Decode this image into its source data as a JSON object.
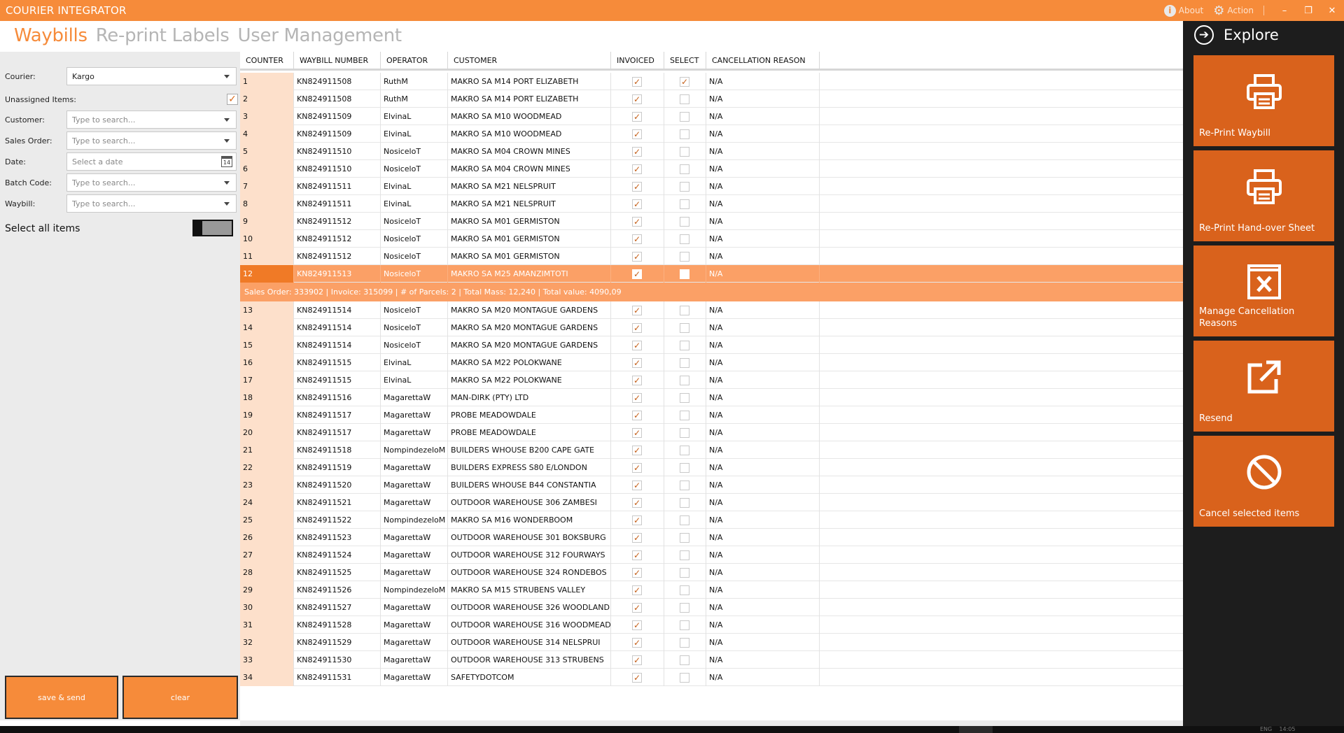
{
  "app": {
    "title": "COURIER INTEGRATOR",
    "about_label": "About",
    "action_label": "Action",
    "about_icon": "i",
    "gear_icon": "⚙",
    "minimize_glyph": "–",
    "restore_glyph": "❐",
    "close_glyph": "✕"
  },
  "nav": {
    "tabs": [
      "Waybills",
      "Re-print Labels",
      "User Management"
    ],
    "active": "Waybills"
  },
  "filters": {
    "courier": {
      "label": "Courier:",
      "value": "Kargo"
    },
    "unassigned": {
      "label": "Unassigned Items:",
      "checked": true,
      "check_glyph": "✓"
    },
    "customer": {
      "label": "Customer:",
      "placeholder": "Type to search..."
    },
    "sales_order": {
      "label": "Sales Order:",
      "placeholder": "Type to search..."
    },
    "date": {
      "label": "Date:",
      "placeholder": "Select a date",
      "cal_day": "14"
    },
    "batch_code": {
      "label": "Batch Code:",
      "placeholder": "Type to search..."
    },
    "waybill": {
      "label": "Waybill:",
      "placeholder": "Type to search..."
    },
    "select_all_label": "Select all items",
    "save_send_label": "save & send",
    "clear_label": "clear"
  },
  "grid": {
    "columns": [
      "COUNTER",
      "WAYBILL NUMBER",
      "OPERATOR",
      "CUSTOMER",
      "INVOICED",
      "SELECT",
      "CANCELLATION REASON"
    ],
    "check_glyph": "✓",
    "selected_counter": "12",
    "detail_text": "Sales Order: 333902 | Invoice: 315099 | # of Parcels: 2 | Total Mass: 12,240 | Total value: 4090,09",
    "rows": [
      {
        "counter": "1",
        "waybill": "KN824911508",
        "operator": "RuthM",
        "customer": "MAKRO SA M14 PORT ELIZABETH",
        "invoiced": true,
        "select": true,
        "reason": "N/A"
      },
      {
        "counter": "2",
        "waybill": "KN824911508",
        "operator": "RuthM",
        "customer": "MAKRO SA M14 PORT ELIZABETH",
        "invoiced": true,
        "select": false,
        "reason": "N/A"
      },
      {
        "counter": "3",
        "waybill": "KN824911509",
        "operator": "ElvinaL",
        "customer": "MAKRO SA M10 WOODMEAD",
        "invoiced": true,
        "select": false,
        "reason": "N/A"
      },
      {
        "counter": "4",
        "waybill": "KN824911509",
        "operator": "ElvinaL",
        "customer": "MAKRO SA M10 WOODMEAD",
        "invoiced": true,
        "select": false,
        "reason": "N/A"
      },
      {
        "counter": "5",
        "waybill": "KN824911510",
        "operator": "NosiceloT",
        "customer": "MAKRO SA M04 CROWN MINES",
        "invoiced": true,
        "select": false,
        "reason": "N/A"
      },
      {
        "counter": "6",
        "waybill": "KN824911510",
        "operator": "NosiceloT",
        "customer": "MAKRO SA M04 CROWN MINES",
        "invoiced": true,
        "select": false,
        "reason": "N/A"
      },
      {
        "counter": "7",
        "waybill": "KN824911511",
        "operator": "ElvinaL",
        "customer": "MAKRO SA M21 NELSPRUIT",
        "invoiced": true,
        "select": false,
        "reason": "N/A"
      },
      {
        "counter": "8",
        "waybill": "KN824911511",
        "operator": "ElvinaL",
        "customer": "MAKRO SA M21 NELSPRUIT",
        "invoiced": true,
        "select": false,
        "reason": "N/A"
      },
      {
        "counter": "9",
        "waybill": "KN824911512",
        "operator": "NosiceloT",
        "customer": "MAKRO SA M01 GERMISTON",
        "invoiced": true,
        "select": false,
        "reason": "N/A"
      },
      {
        "counter": "10",
        "waybill": "KN824911512",
        "operator": "NosiceloT",
        "customer": "MAKRO SA M01 GERMISTON",
        "invoiced": true,
        "select": false,
        "reason": "N/A"
      },
      {
        "counter": "11",
        "waybill": "KN824911512",
        "operator": "NosiceloT",
        "customer": "MAKRO SA M01 GERMISTON",
        "invoiced": true,
        "select": false,
        "reason": "N/A"
      },
      {
        "counter": "12",
        "waybill": "KN824911513",
        "operator": "NosiceloT",
        "customer": "MAKRO SA M25 AMANZIMTOTI",
        "invoiced": true,
        "select": false,
        "reason": "N/A"
      },
      {
        "counter": "13",
        "waybill": "KN824911514",
        "operator": "NosiceloT",
        "customer": "MAKRO SA M20 MONTAGUE GARDENS",
        "invoiced": true,
        "select": false,
        "reason": "N/A"
      },
      {
        "counter": "14",
        "waybill": "KN824911514",
        "operator": "NosiceloT",
        "customer": "MAKRO SA M20 MONTAGUE GARDENS",
        "invoiced": true,
        "select": false,
        "reason": "N/A"
      },
      {
        "counter": "15",
        "waybill": "KN824911514",
        "operator": "NosiceloT",
        "customer": "MAKRO SA M20 MONTAGUE GARDENS",
        "invoiced": true,
        "select": false,
        "reason": "N/A"
      },
      {
        "counter": "16",
        "waybill": "KN824911515",
        "operator": "ElvinaL",
        "customer": "MAKRO SA M22 POLOKWANE",
        "invoiced": true,
        "select": false,
        "reason": "N/A"
      },
      {
        "counter": "17",
        "waybill": "KN824911515",
        "operator": "ElvinaL",
        "customer": "MAKRO SA M22 POLOKWANE",
        "invoiced": true,
        "select": false,
        "reason": "N/A"
      },
      {
        "counter": "18",
        "waybill": "KN824911516",
        "operator": "MagarettaW",
        "customer": "MAN-DIRK (PTY) LTD",
        "invoiced": true,
        "select": false,
        "reason": "N/A"
      },
      {
        "counter": "19",
        "waybill": "KN824911517",
        "operator": "MagarettaW",
        "customer": "PROBE MEADOWDALE",
        "invoiced": true,
        "select": false,
        "reason": "N/A"
      },
      {
        "counter": "20",
        "waybill": "KN824911517",
        "operator": "MagarettaW",
        "customer": "PROBE MEADOWDALE",
        "invoiced": true,
        "select": false,
        "reason": "N/A"
      },
      {
        "counter": "21",
        "waybill": "KN824911518",
        "operator": "NompindezeloM",
        "customer": "BUILDERS WHOUSE B200 CAPE GATE",
        "invoiced": true,
        "select": false,
        "reason": "N/A"
      },
      {
        "counter": "22",
        "waybill": "KN824911519",
        "operator": "MagarettaW",
        "customer": "BUILDERS EXPRESS S80 E/LONDON",
        "invoiced": true,
        "select": false,
        "reason": "N/A"
      },
      {
        "counter": "23",
        "waybill": "KN824911520",
        "operator": "MagarettaW",
        "customer": "BUILDERS WHOUSE B44 CONSTANTIA",
        "invoiced": true,
        "select": false,
        "reason": "N/A"
      },
      {
        "counter": "24",
        "waybill": "KN824911521",
        "operator": "MagarettaW",
        "customer": "OUTDOOR WAREHOUSE 306 ZAMBESI",
        "invoiced": true,
        "select": false,
        "reason": "N/A"
      },
      {
        "counter": "25",
        "waybill": "KN824911522",
        "operator": "NompindezeloM",
        "customer": "MAKRO SA M16 WONDERBOOM",
        "invoiced": true,
        "select": false,
        "reason": "N/A"
      },
      {
        "counter": "26",
        "waybill": "KN824911523",
        "operator": "MagarettaW",
        "customer": "OUTDOOR WAREHOUSE 301 BOKSBURG",
        "invoiced": true,
        "select": false,
        "reason": "N/A"
      },
      {
        "counter": "27",
        "waybill": "KN824911524",
        "operator": "MagarettaW",
        "customer": "OUTDOOR WAREHOUSE 312 FOURWAYS",
        "invoiced": true,
        "select": false,
        "reason": "N/A"
      },
      {
        "counter": "28",
        "waybill": "KN824911525",
        "operator": "MagarettaW",
        "customer": "OUTDOOR WAREHOUSE 324 RONDEBOS",
        "invoiced": true,
        "select": false,
        "reason": "N/A"
      },
      {
        "counter": "29",
        "waybill": "KN824911526",
        "operator": "NompindezeloM",
        "customer": "MAKRO SA M15 STRUBENS VALLEY",
        "invoiced": true,
        "select": false,
        "reason": "N/A"
      },
      {
        "counter": "30",
        "waybill": "KN824911527",
        "operator": "MagarettaW",
        "customer": "OUTDOOR WAREHOUSE 326 WOODLAND",
        "invoiced": true,
        "select": false,
        "reason": "N/A"
      },
      {
        "counter": "31",
        "waybill": "KN824911528",
        "operator": "MagarettaW",
        "customer": "OUTDOOR WAREHOUSE 316 WOODMEAD",
        "invoiced": true,
        "select": false,
        "reason": "N/A"
      },
      {
        "counter": "32",
        "waybill": "KN824911529",
        "operator": "MagarettaW",
        "customer": "OUTDOOR WAREHOUSE 314 NELSPRUI",
        "invoiced": true,
        "select": false,
        "reason": "N/A"
      },
      {
        "counter": "33",
        "waybill": "KN824911530",
        "operator": "MagarettaW",
        "customer": "OUTDOOR WAREHOUSE 313 STRUBENS",
        "invoiced": true,
        "select": false,
        "reason": "N/A"
      },
      {
        "counter": "34",
        "waybill": "KN824911531",
        "operator": "MagarettaW",
        "customer": "SAFETYDOTCOM",
        "invoiced": true,
        "select": false,
        "reason": "N/A"
      }
    ]
  },
  "explore": {
    "title": "Explore",
    "arrow_glyph": "➔",
    "tiles": [
      {
        "label": "Re-Print Waybill",
        "icon": "printer-icon"
      },
      {
        "label": "Re-Print Hand-over Sheet",
        "icon": "printer-icon"
      },
      {
        "label": "Manage Cancellation Reasons",
        "icon": "cancel-box-icon"
      },
      {
        "label": "Resend",
        "icon": "external-link-icon"
      },
      {
        "label": "Cancel selected items",
        "icon": "prohibited-icon"
      }
    ]
  },
  "taskbar": {
    "lang": "ENG",
    "time": "14:05"
  },
  "colors": {
    "accent": "#f68b3a",
    "tile": "#d9621c",
    "selected_row": "#fba066",
    "counter_bg": "#fde0cb",
    "panel_dark": "#1d1d1d"
  }
}
